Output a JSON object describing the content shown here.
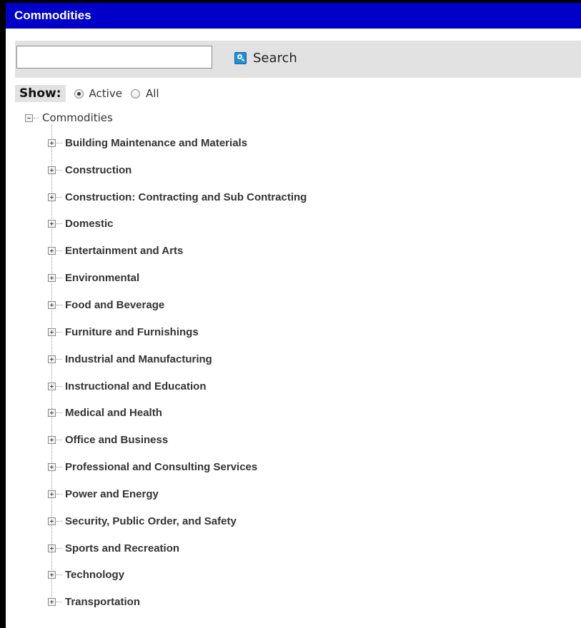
{
  "panel": {
    "title": "Commodities"
  },
  "search": {
    "value": "",
    "placeholder": "",
    "button_label": "Search"
  },
  "show": {
    "label": "Show:",
    "options": [
      {
        "label": "Active",
        "checked": true
      },
      {
        "label": "All",
        "checked": false
      }
    ]
  },
  "tree": {
    "root_label": "Commodities",
    "items": [
      {
        "label": "Building Maintenance and Materials"
      },
      {
        "label": "Construction"
      },
      {
        "label": "Construction: Contracting and Sub Contracting"
      },
      {
        "label": "Domestic"
      },
      {
        "label": "Entertainment and Arts"
      },
      {
        "label": "Environmental"
      },
      {
        "label": "Food and Beverage"
      },
      {
        "label": "Furniture and Furnishings"
      },
      {
        "label": "Industrial and Manufacturing"
      },
      {
        "label": "Instructional and Education"
      },
      {
        "label": "Medical and Health"
      },
      {
        "label": "Office and Business"
      },
      {
        "label": "Professional and Consulting Services"
      },
      {
        "label": "Power and Energy"
      },
      {
        "label": "Security, Public Order, and Safety"
      },
      {
        "label": "Sports and Recreation"
      },
      {
        "label": "Technology"
      },
      {
        "label": "Transportation"
      }
    ]
  },
  "colors": {
    "title_bar": "#0000c8",
    "toolbar_bg": "#e2e2e2",
    "search_icon": "#1e8fd8"
  }
}
